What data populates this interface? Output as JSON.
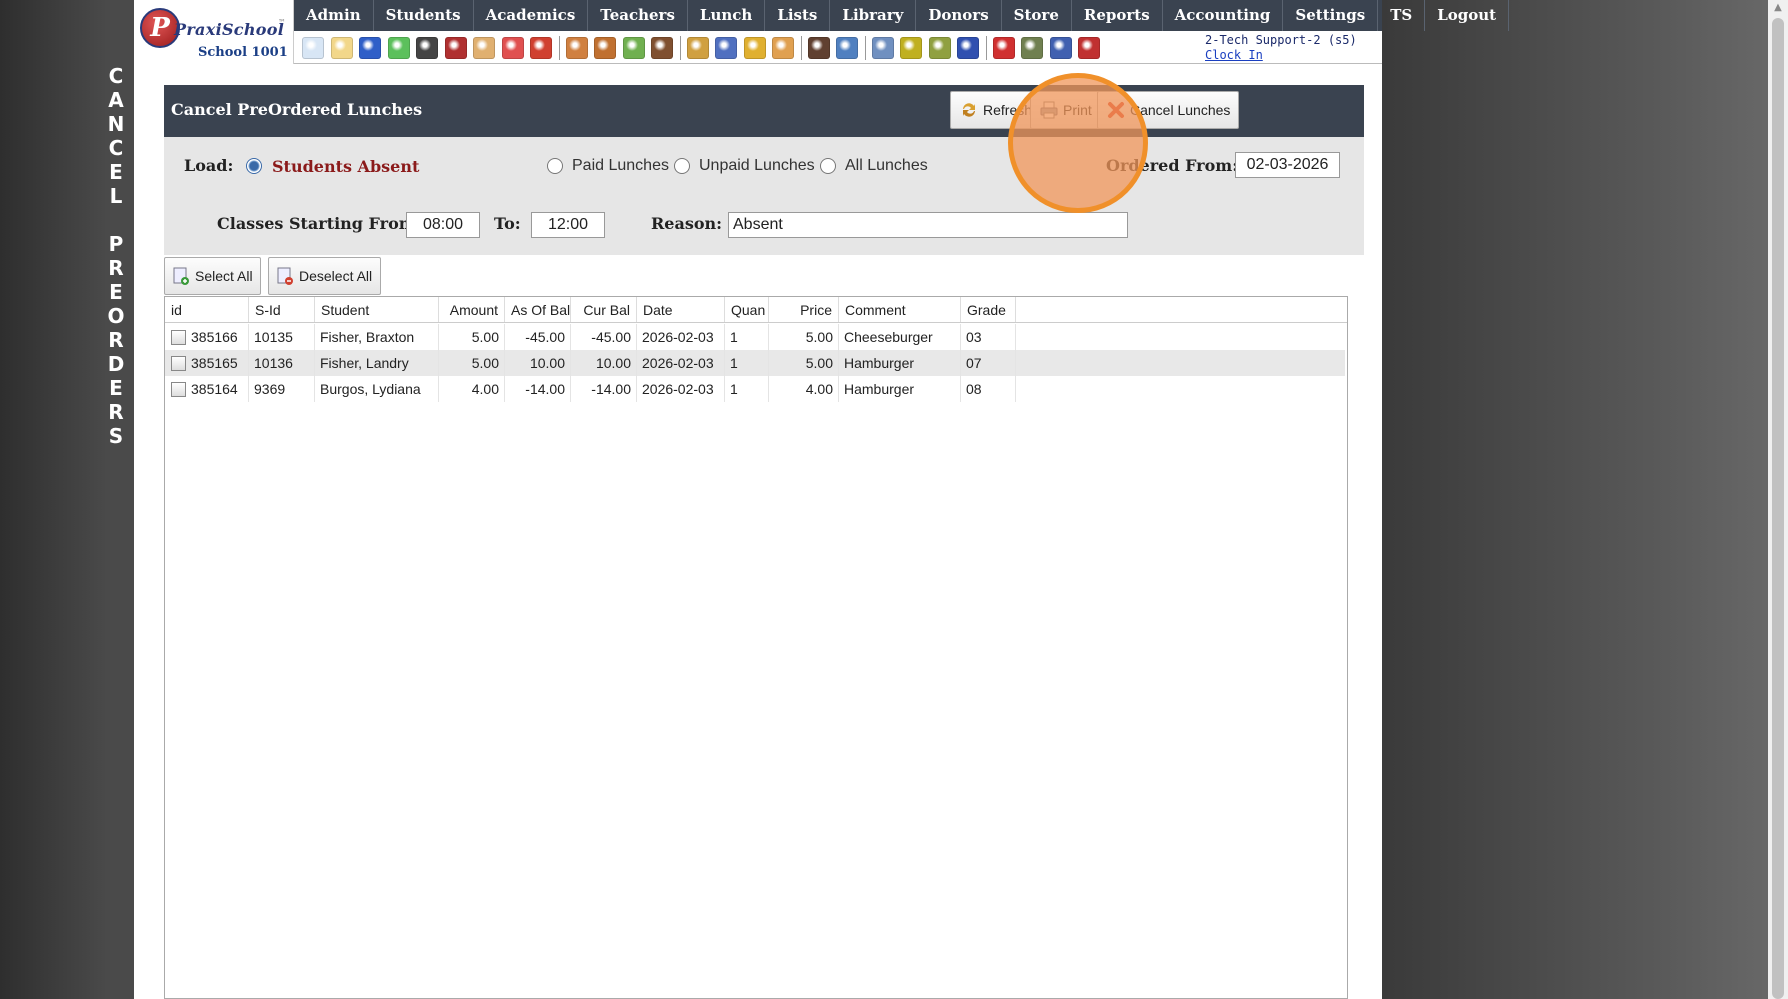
{
  "vertical_title": [
    "C",
    "A",
    "N",
    "C",
    "E",
    "L",
    "",
    "P",
    "R",
    "E",
    "O",
    "R",
    "D",
    "E",
    "R",
    "S"
  ],
  "brand": {
    "logo_letter": "P",
    "name": "PraxiSchool",
    "tm": "™",
    "school": "School 1001"
  },
  "menu": [
    "Admin",
    "Students",
    "Academics",
    "Teachers",
    "Lunch",
    "Lists",
    "Library",
    "Donors",
    "Store",
    "Reports",
    "Accounting",
    "Settings",
    "TS",
    "Logout"
  ],
  "toolbar_icons": [
    {
      "name": "search-icon",
      "color": "#d8e6f5"
    },
    {
      "name": "grid-icon",
      "color": "#f2d78a"
    },
    {
      "name": "at-sign-icon",
      "color": "#2f5fc8"
    },
    {
      "name": "chat-icon",
      "color": "#5cc05c"
    },
    {
      "name": "phone-icon",
      "color": "#444444"
    },
    {
      "name": "speaker-icon",
      "color": "#b03030"
    },
    {
      "name": "form-icon",
      "color": "#e0b070"
    },
    {
      "name": "calendar-icon",
      "color": "#e05050"
    },
    {
      "name": "megaphone-icon",
      "color": "#d04030"
    },
    {
      "name": "sep",
      "color": ""
    },
    {
      "name": "person-icon",
      "color": "#d08040"
    },
    {
      "name": "person-alt-icon",
      "color": "#c07030"
    },
    {
      "name": "money-icon",
      "color": "#70b050"
    },
    {
      "name": "people-icon",
      "color": "#805030"
    },
    {
      "name": "sep",
      "color": ""
    },
    {
      "name": "burger-icon",
      "color": "#d0a040"
    },
    {
      "name": "book-icon",
      "color": "#5070c0"
    },
    {
      "name": "tag-icon",
      "color": "#e0b030"
    },
    {
      "name": "cart-icon",
      "color": "#e0a050"
    },
    {
      "name": "sep",
      "color": ""
    },
    {
      "name": "user-admin-icon",
      "color": "#604030"
    },
    {
      "name": "clock-icon",
      "color": "#5080c0"
    },
    {
      "name": "sep",
      "color": ""
    },
    {
      "name": "spreadsheet-icon",
      "color": "#7090c0"
    },
    {
      "name": "card-icon",
      "color": "#c0b020"
    },
    {
      "name": "printer-money-icon",
      "color": "#90a040"
    },
    {
      "name": "ap-icon",
      "color": "#3050b0"
    },
    {
      "name": "sep",
      "color": ""
    },
    {
      "name": "pdf-icon",
      "color": "#d03030"
    },
    {
      "name": "cash-register-icon",
      "color": "#708050"
    },
    {
      "name": "help-icon",
      "color": "#4060b0"
    },
    {
      "name": "power-icon",
      "color": "#c03030"
    }
  ],
  "user": {
    "name": "2-Tech Support-2 (s5)",
    "clock_in": "Clock In"
  },
  "panel": {
    "title": "Cancel PreOrdered Lunches",
    "refresh": "Refresh",
    "print": "Print",
    "cancel_lunches": "Cancel Lunches"
  },
  "filters": {
    "load_label": "Load:",
    "options": [
      "Students Absent",
      "Paid Lunches",
      "Unpaid Lunches",
      "All Lunches"
    ],
    "selected": "Students Absent",
    "ordered_from_label": "Ordered From:",
    "ordered_from": "02-03-2026",
    "classes_from_label": "Classes Starting From:",
    "classes_from": "08:00",
    "to_label": "To:",
    "to": "12:00",
    "reason_label": "Reason:",
    "reason": "Absent"
  },
  "list_buttons": {
    "select_all": "Select All",
    "deselect_all": "Deselect All"
  },
  "table": {
    "columns": [
      "id",
      "S-Id",
      "Student",
      "Amount",
      "As Of Bal",
      "Cur Bal",
      "Date",
      "Quan",
      "Price",
      "Comment",
      "Grade"
    ],
    "rows": [
      [
        "385166",
        "10135",
        "Fisher, Braxton",
        "5.00",
        "-45.00",
        "-45.00",
        "2026-02-03",
        "1",
        "5.00",
        "Cheeseburger",
        "03"
      ],
      [
        "385165",
        "10136",
        "Fisher, Landry",
        "5.00",
        "10.00",
        "10.00",
        "2026-02-03",
        "1",
        "5.00",
        "Hamburger",
        "07"
      ],
      [
        "385164",
        "9369",
        "Burgos, Lydiana",
        "4.00",
        "-14.00",
        "-14.00",
        "2026-02-03",
        "1",
        "4.00",
        "Hamburger",
        "08"
      ]
    ]
  },
  "colors": {
    "header_bar": "#3a4350",
    "accent_red": "#8b1a1a",
    "highlight": "#f0902a"
  }
}
